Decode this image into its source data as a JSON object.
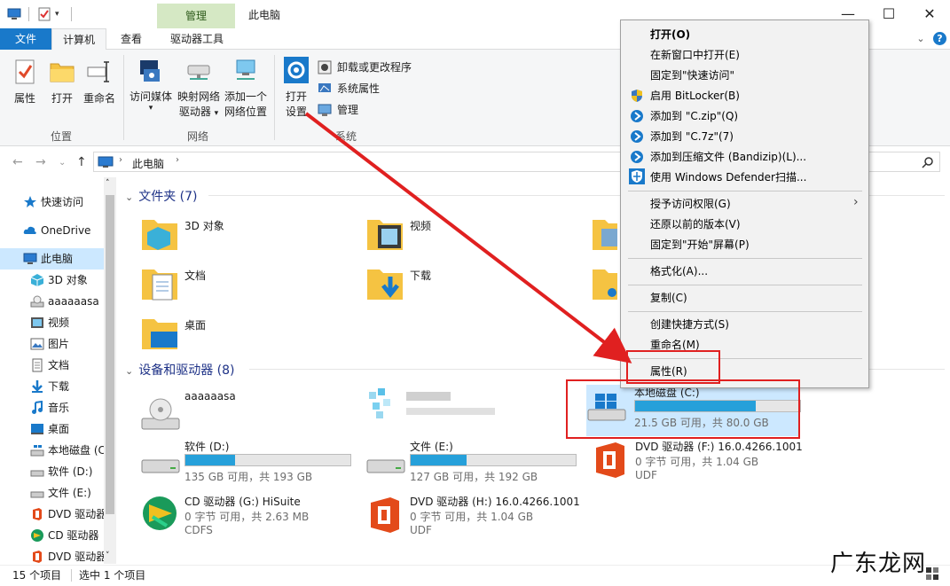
{
  "titlebar": {
    "manage_tab": "管理",
    "title": "此电脑",
    "minimize": "—",
    "maximize": "☐",
    "close": "✕"
  },
  "tabs": {
    "file": "文件",
    "computer": "计算机",
    "view": "查看",
    "drive_tools": "驱动器工具"
  },
  "ribbon": {
    "properties": "属性",
    "open": "打开",
    "rename": "重命名",
    "access_media": "访问媒体",
    "map_drive_1": "映射网络",
    "map_drive_2": "驱动器",
    "add_location_1": "添加一个",
    "add_location_2": "网络位置",
    "open_settings_1": "打开",
    "open_settings_2": "设置",
    "uninstall": "卸载或更改程序",
    "system_properties": "系统属性",
    "manage": "管理",
    "group_location": "位置",
    "group_network": "网络",
    "group_system": "系统"
  },
  "address": {
    "path": "此电脑"
  },
  "sidebar": {
    "items": [
      {
        "label": "快速访问"
      },
      {
        "label": "OneDrive"
      },
      {
        "label": "此电脑"
      },
      {
        "label": "3D 对象"
      },
      {
        "label": "aaaaaasa"
      },
      {
        "label": "视频"
      },
      {
        "label": "图片"
      },
      {
        "label": "文档"
      },
      {
        "label": "下载"
      },
      {
        "label": "音乐"
      },
      {
        "label": "桌面"
      },
      {
        "label": "本地磁盘 (C"
      },
      {
        "label": "软件 (D:)"
      },
      {
        "label": "文件 (E:)"
      },
      {
        "label": "DVD 驱动器"
      },
      {
        "label": "CD 驱动器"
      },
      {
        "label": "DVD 驱动器"
      }
    ]
  },
  "folders_section": {
    "title": "文件夹 (7)",
    "items": [
      {
        "label": "3D 对象"
      },
      {
        "label": "视频"
      },
      {
        "label": "文档"
      },
      {
        "label": "下载"
      },
      {
        "label": "桌面"
      }
    ]
  },
  "devices_section": {
    "title": "设备和驱动器 (8)",
    "drives": [
      {
        "name": "aaaaaasa"
      },
      {
        "name": "本地磁盘 (C:)",
        "info": "21.5 GB 可用，共 80.0 GB",
        "used_fraction": 0.73
      },
      {
        "name": "软件 (D:)",
        "info": "135 GB 可用，共 193 GB",
        "used_fraction": 0.3
      },
      {
        "name": "文件 (E:)",
        "info": "127 GB 可用，共 192 GB",
        "used_fraction": 0.34
      },
      {
        "name": "DVD 驱动器 (F:) 16.0.4266.1001",
        "info": "0 字节 可用，共 1.04 GB",
        "fs": "UDF"
      },
      {
        "name": "CD 驱动器 (G:) HiSuite",
        "info": "0 字节 可用，共 2.63 MB",
        "fs": "CDFS"
      },
      {
        "name": "DVD 驱动器 (H:) 16.0.4266.1001",
        "info": "0 字节 可用，共 1.04 GB",
        "fs": "UDF"
      }
    ]
  },
  "context_menu": {
    "items": [
      {
        "label": "打开(O)"
      },
      {
        "label": "在新窗口中打开(E)"
      },
      {
        "label": "固定到\"快速访问\""
      },
      {
        "label": "启用 BitLocker(B)"
      },
      {
        "label": "添加到 \"C.zip\"(Q)"
      },
      {
        "label": "添加到 \"C.7z\"(7)"
      },
      {
        "label": "添加到压缩文件 (Bandizip)(L)..."
      },
      {
        "label": "使用 Windows Defender扫描..."
      },
      {
        "label": "授予访问权限(G)"
      },
      {
        "label": "还原以前的版本(V)"
      },
      {
        "label": "固定到\"开始\"屏幕(P)"
      },
      {
        "label": "格式化(A)..."
      },
      {
        "label": "复制(C)"
      },
      {
        "label": "创建快捷方式(S)"
      },
      {
        "label": "重命名(M)"
      },
      {
        "label": "属性(R)"
      }
    ]
  },
  "status": {
    "count": "15 个项目",
    "selected": "选中 1 个项目"
  },
  "watermark": "广东龙网",
  "colors": {
    "accent": "#1979ca",
    "manage_tab": "#d5e8c4",
    "selection": "#cce8ff",
    "highlight_red": "#e02020",
    "drive_bar": "#26a0da"
  }
}
